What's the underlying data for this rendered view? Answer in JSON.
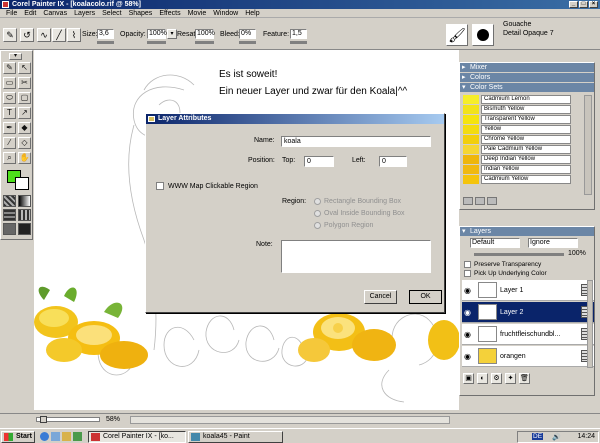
{
  "window": {
    "title": "Corel Painter IX - [koalacolo.rif @ 58%]"
  },
  "menu": [
    "File",
    "Edit",
    "Canvas",
    "Layers",
    "Select",
    "Shapes",
    "Effects",
    "Movie",
    "Window",
    "Help"
  ],
  "property_bar": {
    "size_label": "Size:",
    "size_value": "3,6",
    "opacity_label": "Opacity:",
    "opacity_value": "100%",
    "resat_label": "Resat:",
    "resat_value": "100%",
    "bleed_label": "Bleed:",
    "bleed_value": "0%",
    "feature_label": "Feature:",
    "feature_value": "1,5",
    "brush_category": "Gouache",
    "brush_variant": "Detail Opaque 7"
  },
  "canvas": {
    "text_line1": "Es ist soweit!",
    "text_line2": "Ein neuer Layer und zwar für den Koala|^^"
  },
  "panels": {
    "mixer": "Mixer",
    "colors": "Colors",
    "color_sets": "Color Sets",
    "swatches": [
      {
        "name": "Cadmium Lemon",
        "color": "#f6ee2a"
      },
      {
        "name": "Bismuth Yellow",
        "color": "#f2e31a"
      },
      {
        "name": "Transparent Yellow",
        "color": "#f5e40e"
      },
      {
        "name": "Yellow",
        "color": "#f3dc10"
      },
      {
        "name": "Chrome Yellow",
        "color": "#f2cf0c"
      },
      {
        "name": "Pale Cadmium Yellow",
        "color": "#f5d633"
      },
      {
        "name": "Deep Indian Yellow",
        "color": "#eeb60c"
      },
      {
        "name": "Indian Yellow",
        "color": "#f0b911"
      },
      {
        "name": "Cadmium Yellow",
        "color": "#f4c40d"
      }
    ],
    "layers": {
      "title": "Layers",
      "composite_method": "Default",
      "depth_method": "Ignore",
      "opacity": "100%",
      "preserve_transparency": "Preserve Transparency",
      "pick_up_underlying": "Pick Up Underlying Color",
      "items": [
        {
          "name": "Layer 1"
        },
        {
          "name": "Layer 2"
        },
        {
          "name": "fruchtfleischundbl..."
        },
        {
          "name": "orangen"
        }
      ]
    }
  },
  "dialog": {
    "title": "Layer Attributes",
    "name_label": "Name:",
    "name_value": "koala",
    "position_label": "Position:",
    "top_label": "Top:",
    "top_value": "0",
    "left_label": "Left:",
    "left_value": "0",
    "wwwmap_label": "WWW Map Clickable Region",
    "region_label": "Region:",
    "region_options": [
      "Rectangle Bounding Box",
      "Oval Inside Bounding Box",
      "Polygon Region"
    ],
    "note_label": "Note:",
    "cancel_label": "Cancel",
    "ok_label": "OK"
  },
  "statusbar": {
    "zoom": "58%"
  },
  "taskbar": {
    "start": "Start",
    "task1": "Corel Painter IX - [ko...",
    "task2": "koala45 - Paint",
    "lang": "DE",
    "clock": "14:24"
  },
  "colors": {
    "accent": "#0a246a",
    "panel_head": "#6b86a6",
    "primary_color": "#4de01a",
    "secondary_color": "#ffffff"
  }
}
